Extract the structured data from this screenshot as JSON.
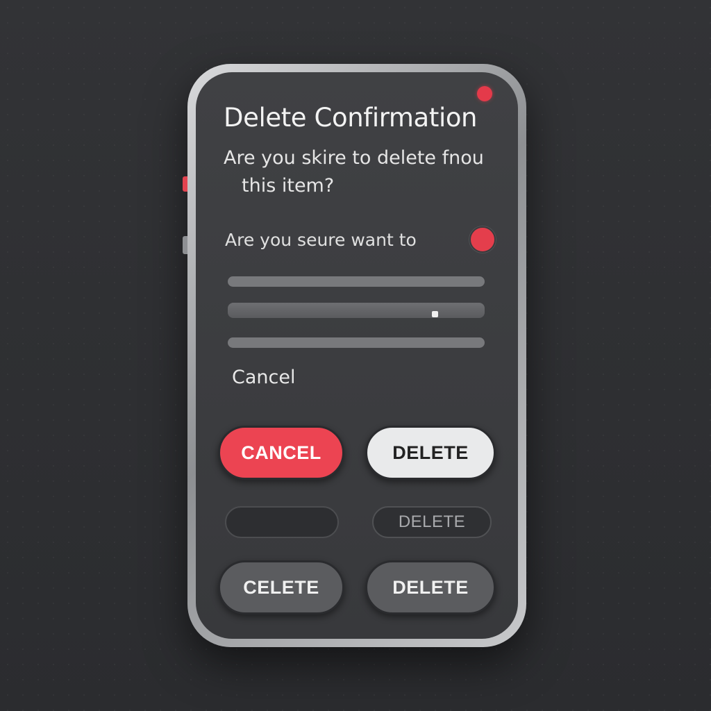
{
  "dialog": {
    "title": "Delete Confirmation",
    "message_line1": "Are you skire to delete fnou",
    "message_line2": "this item?",
    "sub_text": "Are you seure  want  to",
    "cancel_link": "Cancel"
  },
  "buttons": {
    "cancel_primary": "CANCEL",
    "delete_primary": "DELETE",
    "delete_ghost": "DELETE",
    "celete": "CELETE",
    "delete_secondary": "DELETE"
  },
  "colors": {
    "accent_red": "#ec4452",
    "screen_bg": "#3c3d40",
    "light_button": "#e9eaeb",
    "dark_button": "#5b5c5f"
  }
}
